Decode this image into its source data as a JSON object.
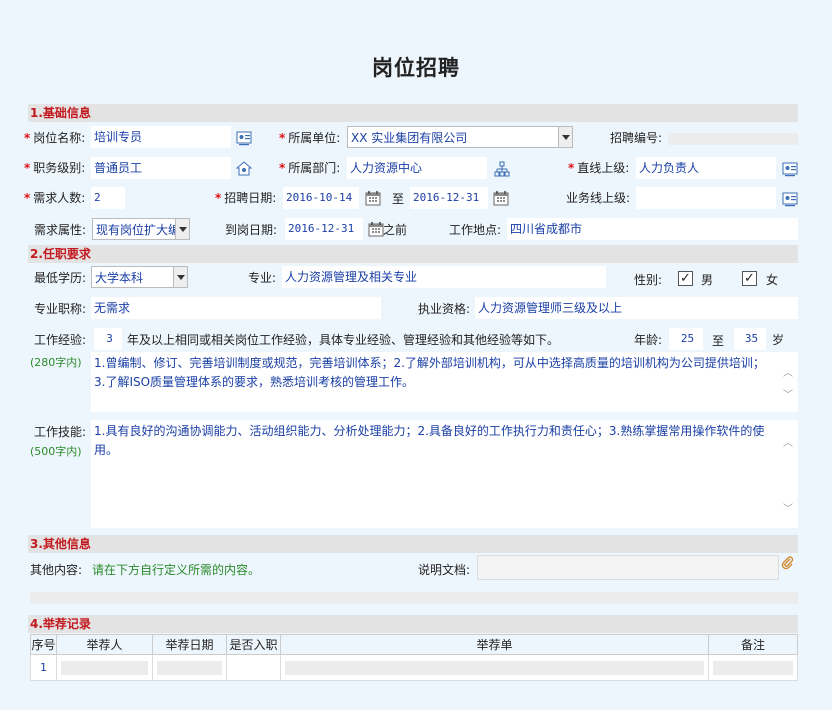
{
  "title": "岗位招聘",
  "sections": {
    "basic": "1.基础信息",
    "requirements": "2.任职要求",
    "other": "3.其他信息",
    "records": "4.举荐记录"
  },
  "basic": {
    "position_name_label": "岗位名称:",
    "position_name": "培训专员",
    "unit_label": "所属单位:",
    "unit": "XX 实业集团有限公司",
    "recruit_no_label": "招聘编号:",
    "grade_label": "职务级别:",
    "grade": "普通员工",
    "dept_label": "所属部门:",
    "dept": "人力资源中心",
    "superior_label": "直线上级:",
    "superior": "人力负责人",
    "headcount_label": "需求人数:",
    "headcount": "2",
    "recruit_date_label": "招聘日期:",
    "recruit_start": "2016-10-14",
    "to_label": "至",
    "recruit_end": "2016-12-31",
    "business_superior_label": "业务线上级:",
    "demand_type_label": "需求属性:",
    "demand_type": "现有岗位扩大编",
    "onboard_label": "到岗日期:",
    "onboard_date": "2016-12-31",
    "before_label": "之前",
    "location_label": "工作地点:",
    "location": "四川省成都市"
  },
  "requirements": {
    "education_label": "最低学历:",
    "education": "大学本科",
    "major_label": "专业:",
    "major": "人力资源管理及相关专业",
    "gender_label": "性别:",
    "male_label": "男",
    "female_label": "女",
    "title_label": "专业职称:",
    "title_value": "无需求",
    "qualification_label": "执业资格:",
    "qualification": "人力资源管理师三级及以上",
    "experience_label": "工作经验:",
    "experience_years": "3",
    "experience_text": "年及以上相同或相关岗位工作经验，具体专业经验、管理经验和其他经验等如下。",
    "age_label": "年龄:",
    "age_min": "25",
    "age_to": "至",
    "age_max": "35",
    "age_unit": "岁",
    "exp_limit": "(280字内)",
    "experience_detail": "1.曾编制、修订、完善培训制度或规范，完善培训体系；2.了解外部培训机构，可从中选择高质量的培训机构为公司提供培训；3.了解ISO质量管理体系的要求，熟悉培训考核的管理工作。",
    "skills_label": "工作技能:",
    "skills_limit": "(500字内)",
    "skills_detail": "1.具有良好的沟通协调能力、活动组织能力、分析处理能力；2.具备良好的工作执行力和责任心；3.熟练掌握常用操作软件的使用。"
  },
  "other": {
    "content_label": "其他内容:",
    "content_hint": "请在下方自行定义所需的内容。",
    "doc_label": "说明文档:"
  },
  "records": {
    "headers": [
      "序号",
      "举荐人",
      "举荐日期",
      "是否入职",
      "举荐单",
      "备注"
    ],
    "rows": [
      {
        "no": "1"
      }
    ]
  },
  "icons": [
    "person-card-icon",
    "dropdown-arrow-icon",
    "org-chart-icon",
    "calendar-icon",
    "paperclip-icon",
    "checkbox-checked-icon"
  ],
  "colors": {
    "section_title": "#c2181e",
    "value_text": "#1a3fa6",
    "hint_green": "#2a8a2a",
    "background": "#eef6fd"
  }
}
